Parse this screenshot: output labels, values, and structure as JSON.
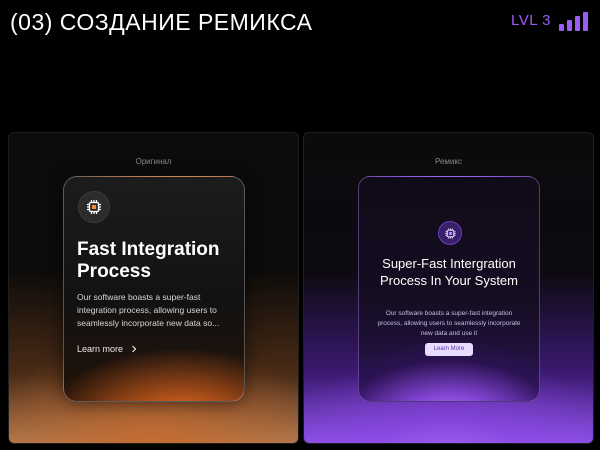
{
  "header": {
    "title": "(03) СОЗДАНИЕ РЕМИКСА",
    "level_label": "LVL 3",
    "level_bars": [
      1,
      1,
      1,
      1
    ],
    "accent_color": "#9b5cf6"
  },
  "panels": {
    "original": {
      "label": "Оригинал",
      "card": {
        "icon": "chip-icon",
        "title": "Fast Integration Process",
        "description": "Our software boasts a super-fast integration process, allowing users to seamlessly incorporate new data so...",
        "link_label": "Learn more",
        "link_icon": "chevron-right-icon"
      }
    },
    "remix": {
      "label": "Ремикс",
      "card": {
        "icon": "chip-icon",
        "title": "Super-Fast Intergration Process In Your System",
        "description": "Our software boasts a super-fast integration process, allowing users to seamlessly incorporate new data and use it",
        "button_label": "Learn More"
      }
    }
  }
}
